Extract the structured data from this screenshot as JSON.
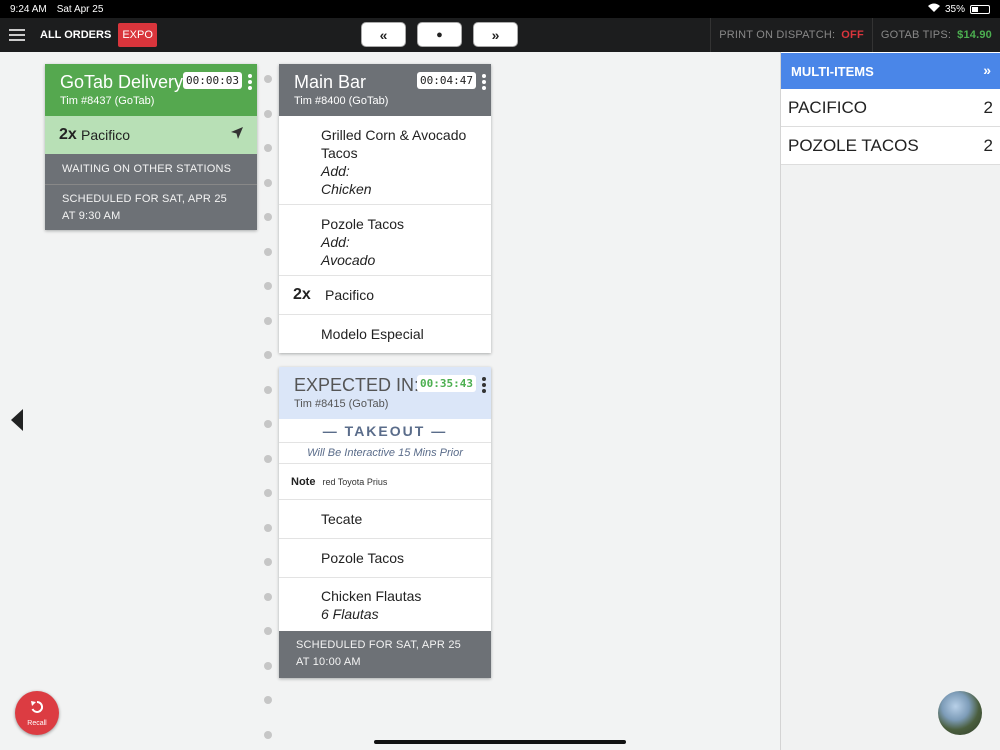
{
  "status": {
    "time": "9:24 AM",
    "date": "Sat Apr 25",
    "battery": "35%"
  },
  "topbar": {
    "all_orders": "ALL ORDERS",
    "expo": "EXPO",
    "nav": {
      "prev_all": "«",
      "home": "●",
      "next_all": "»"
    },
    "print_on_dispatch_label": "PRINT ON DISPATCH:",
    "print_on_dispatch_value": "OFF",
    "gotab_tips_label": "GOTAB TIPS:",
    "gotab_tips_value": "$14.90"
  },
  "card1": {
    "title": "GoTab Delivery 1",
    "timer": "00:00:03",
    "sub": "Tim #8437 (GoTab)",
    "item": {
      "qty": "2x",
      "name": "Pacifico"
    },
    "waiting": "WAITING ON OTHER STATIONS",
    "scheduled": "SCHEDULED FOR SAT, APR 25 AT 9:30 AM"
  },
  "card2": {
    "title": "Main Bar",
    "timer": "00:04:47",
    "sub": "Tim #8400 (GoTab)",
    "items": [
      {
        "qty": "",
        "name": "Grilled Corn & Avocado Tacos",
        "mod1": "Add:",
        "mod2": "Chicken"
      },
      {
        "qty": "",
        "name": "Pozole Tacos",
        "mod1": "Add:",
        "mod2": "Avocado"
      },
      {
        "qty": "2x",
        "name": "Pacifico"
      },
      {
        "qty": "",
        "name": "Modelo Especial"
      }
    ]
  },
  "card3": {
    "title": "EXPECTED IN:",
    "timer": "00:35:43",
    "sub": "Tim #8415 (GoTab)",
    "takeout": "—  TAKEOUT  —",
    "interactive": "Will Be Interactive 15 Mins Prior",
    "note_label": "Note",
    "note_text": "red Toyota Prius",
    "items": [
      {
        "name": "Tecate"
      },
      {
        "name": "Pozole Tacos"
      },
      {
        "name": "Chicken Flautas",
        "mod": "6 Flautas"
      }
    ],
    "scheduled": "SCHEDULED FOR SAT, APR 25 AT 10:00 AM"
  },
  "panel": {
    "title": "MULTI-ITEMS",
    "chevron": "»",
    "rows": [
      {
        "name": "PACIFICO",
        "count": "2"
      },
      {
        "name": "POZOLE TACOS",
        "count": "2"
      }
    ]
  },
  "recall": {
    "label": "Recall"
  },
  "colors": {
    "green": "#55a84f",
    "gray": "#6d7176",
    "blue": "#4a86e8",
    "red": "#dc3c42"
  }
}
